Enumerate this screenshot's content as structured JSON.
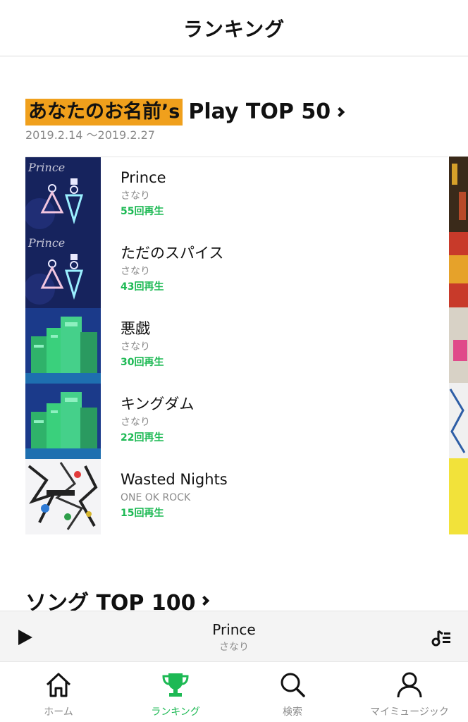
{
  "header": {
    "title": "ランキング"
  },
  "section1": {
    "name_highlight": "あなたのお名前’s",
    "title_rest": "Play TOP 50",
    "date_range": "2019.2.14 ～2019.2.27"
  },
  "ranking": [
    {
      "title": "Prince",
      "artist": "さなり",
      "plays": "55回再生"
    },
    {
      "title": "ただのスパイス",
      "artist": "さなり",
      "plays": "43回再生"
    },
    {
      "title": "悪戯",
      "artist": "さなり",
      "plays": "30回再生"
    },
    {
      "title": "キングダム",
      "artist": "さなり",
      "plays": "22回再生"
    },
    {
      "title": "Wasted Nights",
      "artist": "ONE OK ROCK",
      "plays": "15回再生"
    }
  ],
  "album_art_text": {
    "prince": "Prince"
  },
  "section2": {
    "title": "ソング TOP 100"
  },
  "now_playing": {
    "title": "Prince",
    "artist": "さなり"
  },
  "tabs": [
    {
      "label": "ホーム",
      "icon": "home-icon"
    },
    {
      "label": "ランキング",
      "icon": "trophy-icon",
      "active": true
    },
    {
      "label": "検索",
      "icon": "search-icon"
    },
    {
      "label": "マイミュージック",
      "icon": "person-icon"
    }
  ],
  "colors": {
    "accent": "#1db954",
    "highlight": "#f0a01c"
  }
}
